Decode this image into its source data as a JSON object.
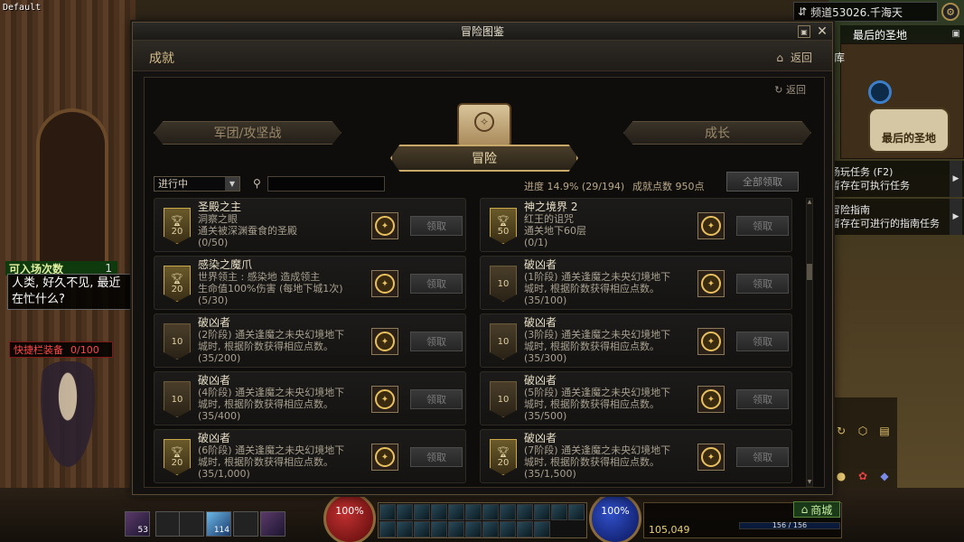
{
  "debug_label": "Default",
  "channel": {
    "label": "频道53026.千海天"
  },
  "map": {
    "title": "最后的圣地",
    "place": "最后的圣地",
    "lib": "库"
  },
  "quests": [
    {
      "title": "场玩任务 (F2)",
      "subtitle": "暂存在可执行任务"
    },
    {
      "title": "冒险指南",
      "subtitle": "暂存在可进行的指南任务"
    }
  ],
  "chat": {
    "tag": "可入场次数",
    "tag_count": "1",
    "speech_line1": "人类, 好久不见, 最近",
    "speech_line2": "在忙什么?",
    "quickbar_label": "快捷栏装备",
    "quickbar_count": "0/100"
  },
  "hud": {
    "hp_percent": "100%",
    "mp_percent": "100%",
    "gold": "105,049",
    "shop_label": "商城",
    "bar_text": "156 / 156",
    "skill_counts": [
      "53",
      "",
      "",
      "114",
      ""
    ]
  },
  "window": {
    "title": "冒险图鉴",
    "section_title": "成就",
    "back_label": "返回",
    "inner_back": "返回",
    "tabs": {
      "left": "军团/攻坚战",
      "center": "冒险",
      "right": "成长"
    },
    "filter": {
      "selected": "进行中"
    },
    "progress_label": "进度 14.9% (29/194)",
    "points_label": "成就点数 950点",
    "claim_all": "全部领取"
  },
  "achievements": [
    {
      "name": "圣殿之主",
      "line1": "洞察之眼",
      "line2": "通关被深渊蚕食的圣殿",
      "progress": "(0/50)",
      "points": "20",
      "trophy": true,
      "claim": "领取"
    },
    {
      "name": "神之境界 2",
      "line1": "红王的诅咒",
      "line2": "通关地下60层",
      "progress": "(0/1)",
      "points": "50",
      "trophy": true,
      "claim": "领取"
    },
    {
      "name": "感染之魔爪",
      "line1": "世界领主 : 感染地      造成领主",
      "line2": "生命值100%伤害 (每地下城1次)",
      "progress": "(5/30)",
      "points": "20",
      "trophy": true,
      "claim": "领取"
    },
    {
      "name": "破凶者",
      "line1": "(1阶段) 通关逢魔之未央幻境地下",
      "line2": "城时, 根据阶数获得相应点数。",
      "progress": "(35/100)",
      "points": "10",
      "trophy": false,
      "claim": "领取"
    },
    {
      "name": "破凶者",
      "line1": "(2阶段) 通关逢魔之未央幻境地下",
      "line2": "城时, 根据阶数获得相应点数。",
      "progress": "(35/200)",
      "points": "10",
      "trophy": false,
      "claim": "领取"
    },
    {
      "name": "破凶者",
      "line1": "(3阶段) 通关逢魔之未央幻境地下",
      "line2": "城时, 根据阶数获得相应点数。",
      "progress": "(35/300)",
      "points": "10",
      "trophy": false,
      "claim": "领取"
    },
    {
      "name": "破凶者",
      "line1": "(4阶段) 通关逢魔之未央幻境地下",
      "line2": "城时, 根据阶数获得相应点数。",
      "progress": "(35/400)",
      "points": "10",
      "trophy": false,
      "claim": "领取"
    },
    {
      "name": "破凶者",
      "line1": "(5阶段) 通关逢魔之未央幻境地下",
      "line2": "城时, 根据阶数获得相应点数。",
      "progress": "(35/500)",
      "points": "10",
      "trophy": false,
      "claim": "领取"
    },
    {
      "name": "破凶者",
      "line1": "(6阶段) 通关逢魔之未央幻境地下",
      "line2": "城时, 根据阶数获得相应点数。",
      "progress": "(35/1,000)",
      "points": "20",
      "trophy": true,
      "claim": "领取"
    },
    {
      "name": "破凶者",
      "line1": "(7阶段) 通关逢魔之未央幻境地下",
      "line2": "城时, 根据阶数获得相应点数。",
      "progress": "(35/1,500)",
      "points": "20",
      "trophy": true,
      "claim": "领取"
    }
  ]
}
